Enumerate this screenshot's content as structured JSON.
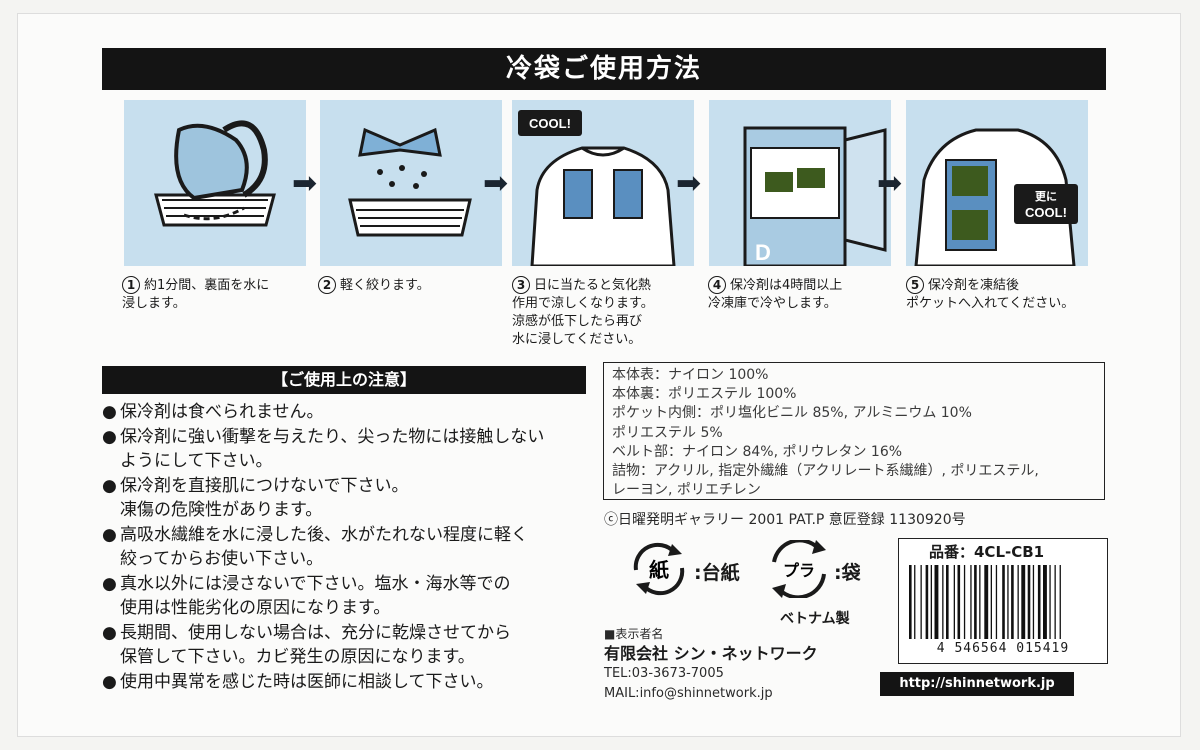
{
  "title": "冷袋ご使用方法",
  "steps": [
    {
      "num": "1",
      "line1": "約1分間、裏面を水に",
      "line2": "浸します。",
      "line3": "",
      "line4": ""
    },
    {
      "num": "2",
      "line1": "軽く絞ります。",
      "line2": "",
      "line3": "",
      "line4": ""
    },
    {
      "num": "3",
      "line1": "日に当たると気化熱",
      "line2": "作用で涼しくなります。",
      "line3": "涼感が低下したら再び",
      "line4": "水に浸してください。"
    },
    {
      "num": "4",
      "line1": "保冷剤は4時間以上",
      "line2": "冷凍庫で冷やします。",
      "line3": "",
      "line4": ""
    },
    {
      "num": "5",
      "line1": "保冷剤を凍結後",
      "line2": "ポケットへ入れてください。",
      "line3": "",
      "line4": ""
    }
  ],
  "illustration_labels": {
    "cool": "COOL!",
    "more1": "更に",
    "more2": "COOL!",
    "freezer_mark": "D"
  },
  "caution": {
    "header": "【ご使用上の注意】",
    "bullet": "●",
    "items": [
      [
        "保冷剤は食べられません。"
      ],
      [
        "保冷剤に強い衝撃を与えたり、尖った物には接触しない",
        "ようにして下さい。"
      ],
      [
        "保冷剤を直接肌につけないで下さい。",
        "凍傷の危険性があります。"
      ],
      [
        "高吸水繊維を水に浸した後、水がたれない程度に軽く",
        "絞ってからお使い下さい。"
      ],
      [
        "真水以外には浸さないで下さい。塩水・海水等での",
        "使用は性能劣化の原因になります。"
      ],
      [
        "長期間、使用しない場合は、充分に乾燥させてから",
        "保管して下さい。カビ発生の原因になります。"
      ],
      [
        "使用中異常を感じた時は医師に相談して下さい。"
      ]
    ]
  },
  "materials": [
    "本体表：ナイロン 100%",
    "本体裏：ポリエステル 100%",
    "ポケット内側：ポリ塩化ビニル 85%, アルミニウム 10%",
    "ポリエステル 5%",
    "ベルト部：ナイロン 84%, ポリウレタン 16%",
    "詰物：アクリル, 指定外繊維（アクリレート系繊維）, ポリエステル,",
    "レーヨン, ポリエチレン"
  ],
  "copyright": "ⓒ日曜発明ギャラリー 2001 PAT.P  意匠登録 1130920号",
  "recycle": {
    "paper_mark": "紙",
    "paper_label": ":台紙",
    "plastic_mark": "プラ",
    "plastic_label": ":袋"
  },
  "made_in": "ベトナム製",
  "publisher": {
    "label": "■表示者名",
    "company": "有限会社 シン・ネットワーク",
    "tel": "TEL:03-3673-7005",
    "mail": "MAIL:info@shinnetwork.jp"
  },
  "product": {
    "part_number": "品番：4CL-CB1",
    "barcode_digits": "4 546564 015419"
  },
  "url": "http://shinnetwork.jp",
  "colors": {
    "illustration_bg": "#c7dfee",
    "bar_black": "#141414",
    "accent_green": "#3d5a1e",
    "shirt_blue": "#5a8fc0"
  }
}
